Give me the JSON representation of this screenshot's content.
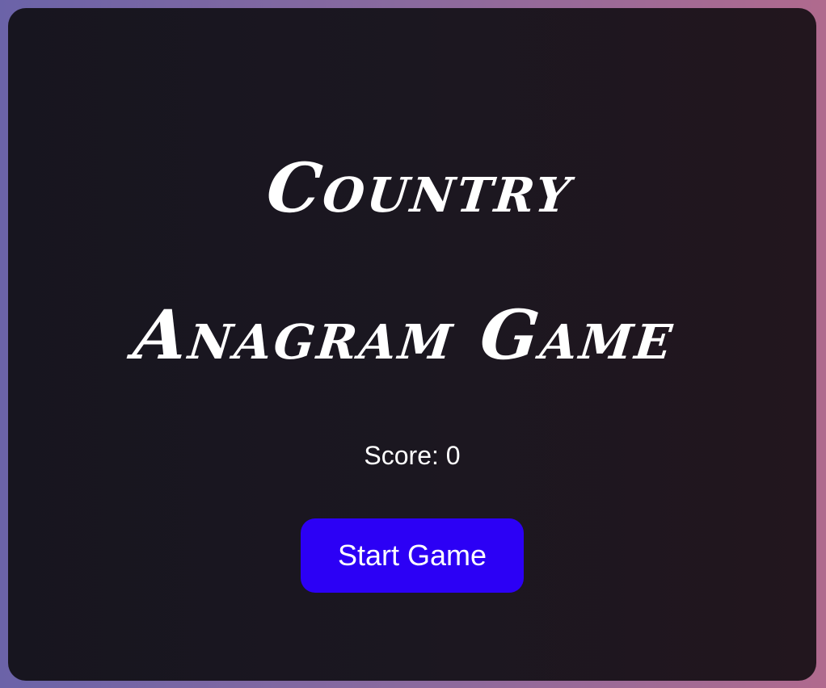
{
  "game": {
    "title_line1": "Country",
    "title_line2": "Anagram Game",
    "score_label": "Score:",
    "score_value": "0",
    "start_label": "Start Game"
  },
  "colors": {
    "card_background": "#1b1720",
    "button_background": "#2c00f5",
    "text": "#ffffff"
  }
}
